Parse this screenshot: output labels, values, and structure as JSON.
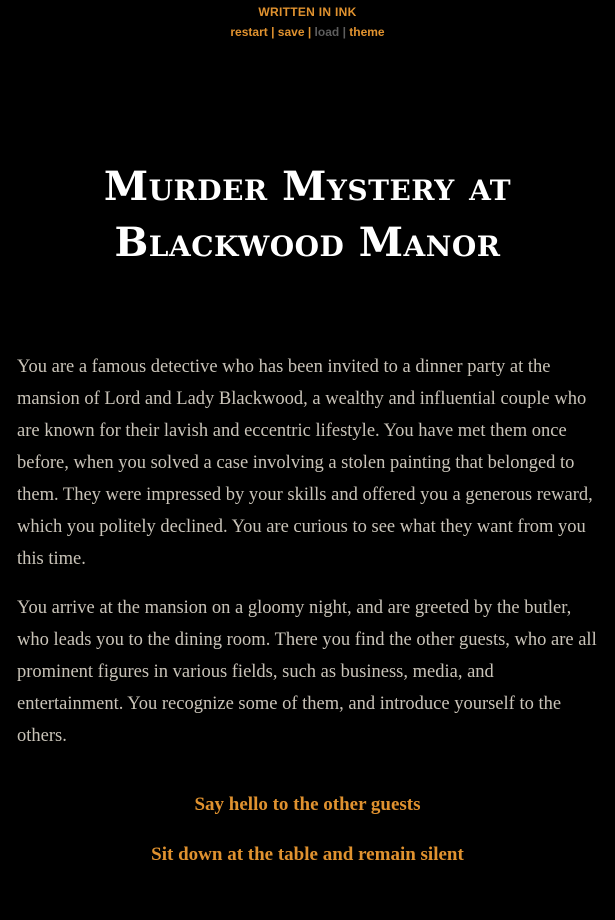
{
  "header": {
    "brand": "WRITTEN IN INK",
    "controls": [
      {
        "label": "restart",
        "enabled": true
      },
      {
        "label": "save",
        "enabled": true
      },
      {
        "label": "load",
        "enabled": false
      },
      {
        "label": "theme",
        "enabled": true
      }
    ],
    "separator": "|"
  },
  "story": {
    "title": "Murder Mystery at Blackwood Manor",
    "paragraphs": [
      "You are a famous detective who has been invited to a dinner party at the mansion of Lord and Lady Blackwood, a wealthy and influential couple who are known for their lavish and eccentric lifestyle. You have met them once before, when you solved a case involving a stolen painting that belonged to them. They were impressed by your skills and offered you a generous reward, which you politely declined. You are curious to see what they want from you this time.",
      "You arrive at the mansion on a gloomy night, and are greeted by the butler, who leads you to the dining room. There you find the other guests, who are all prominent figures in various fields, such as business, media, and entertainment. You recognize some of them, and introduce yourself to the others."
    ],
    "choices": [
      "Say hello to the other guests",
      "Sit down at the table and remain silent"
    ]
  },
  "colors": {
    "background": "#000000",
    "accent": "#e0922f",
    "text": "#c9c3b8",
    "title": "#ffffff",
    "disabled": "#5d5d5d"
  }
}
